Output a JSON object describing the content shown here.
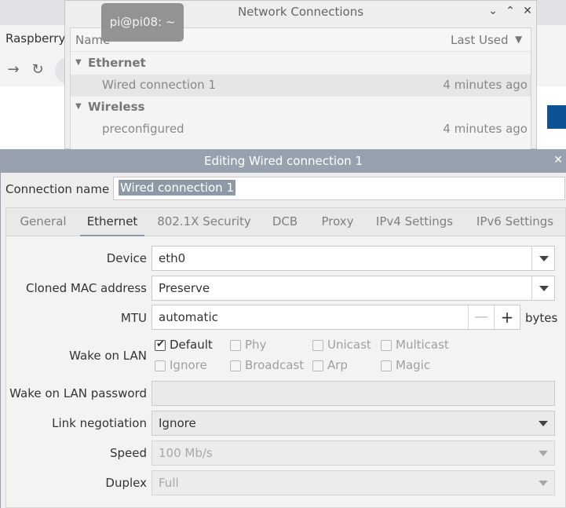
{
  "browser": {
    "tab_title": "Raspberry",
    "back_icon": "arrow-right-icon",
    "reload_icon": "reload-icon",
    "accent_color": "#0b5394"
  },
  "network_connections": {
    "title": "Network Connections",
    "controls": [
      "⌄",
      "⌃",
      "✕"
    ],
    "columns": {
      "name": "Name",
      "last_used": "Last Used"
    },
    "groups": [
      {
        "label": "Ethernet",
        "items": [
          {
            "name": "Wired connection 1",
            "last_used": "4 minutes ago",
            "selected": true
          }
        ]
      },
      {
        "label": "Wireless",
        "items": [
          {
            "name": "preconfigured",
            "last_used": "4 minutes ago",
            "selected": false
          }
        ]
      }
    ]
  },
  "tooltip": {
    "text": "pi@pi08: ~"
  },
  "editor": {
    "title": "Editing Wired connection 1",
    "close": "✕",
    "connection_name_label": "Connection name",
    "connection_name_value": "Wired connection 1",
    "tabs": [
      "General",
      "Ethernet",
      "802.1X Security",
      "DCB",
      "Proxy",
      "IPv4 Settings",
      "IPv6 Settings"
    ],
    "active_tab": "Ethernet",
    "ethernet": {
      "device_label": "Device",
      "device_value": "eth0",
      "cloned_mac_label": "Cloned MAC address",
      "cloned_mac_value": "Preserve",
      "mtu_label": "MTU",
      "mtu_value": "automatic",
      "mtu_minus": "—",
      "mtu_plus": "+",
      "mtu_unit": "bytes",
      "wol_label": "Wake on LAN",
      "wol_options": {
        "default": {
          "label": "Default",
          "checked": true
        },
        "phy": {
          "label": "Phy",
          "checked": false
        },
        "unicast": {
          "label": "Unicast",
          "checked": false
        },
        "multicast": {
          "label": "Multicast",
          "checked": false
        },
        "ignore": {
          "label": "Ignore",
          "checked": false
        },
        "broadcast": {
          "label": "Broadcast",
          "checked": false
        },
        "arp": {
          "label": "Arp",
          "checked": false
        },
        "magic": {
          "label": "Magic",
          "checked": false
        }
      },
      "wol_password_label": "Wake on LAN password",
      "wol_password_value": "",
      "link_negotiation_label": "Link negotiation",
      "link_negotiation_value": "Ignore",
      "speed_label": "Speed",
      "speed_value": "100 Mb/s",
      "duplex_label": "Duplex",
      "duplex_value": "Full"
    }
  }
}
